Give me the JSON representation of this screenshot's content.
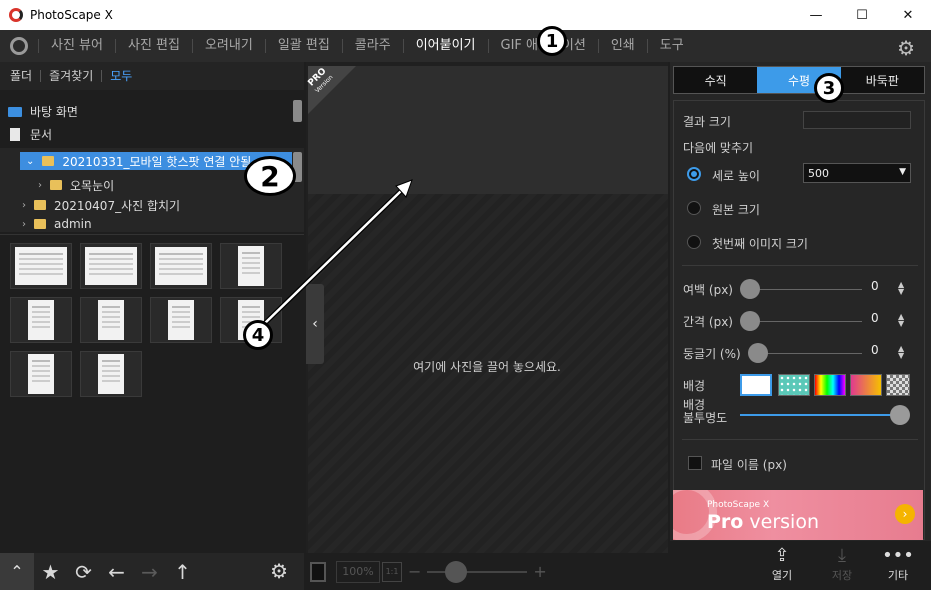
{
  "window": {
    "title": "PhotoScape X",
    "minimize": "—",
    "maximize": "☐",
    "close": "✕"
  },
  "menu": {
    "items": [
      "사진 뷰어",
      "사진 편집",
      "오려내기",
      "일괄 편집",
      "콜라주",
      "이어붙이기",
      "GIF 애니메이션",
      "인쇄",
      "도구"
    ],
    "active": "이어붙이기"
  },
  "browser": {
    "tabs": [
      "폴더",
      "즐겨찾기",
      "모두"
    ],
    "tree_top": [
      {
        "label": "바탕 화면"
      },
      {
        "label": "문서"
      }
    ],
    "tree": [
      {
        "label": "20210331_모바일 핫스팟 연결 안될",
        "selected": true
      },
      {
        "label": "오목눈이"
      },
      {
        "label": "20210407_사진 합치기"
      },
      {
        "label": "admin"
      }
    ]
  },
  "canvas": {
    "pro_label": "PRO",
    "pro_sub": "Version",
    "drop_hint": "여기에 사진을 끌어 놓으세요."
  },
  "zoom": {
    "value": "100%",
    "fit": "1:1"
  },
  "panel": {
    "tabs": [
      "수직",
      "수평",
      "바둑판"
    ],
    "active_tab": "수평",
    "result_size_label": "결과 크기",
    "fit_label": "다음에 맞추기",
    "options": [
      "세로 높이",
      "원본 크기",
      "첫번째 이미지 크기"
    ],
    "height_value": "500",
    "margin_label": "여백 (px)",
    "margin_value": "0",
    "spacing_label": "간격 (px)",
    "spacing_value": "0",
    "round_label": "둥글기 (%)",
    "round_value": "0",
    "bg_label": "배경",
    "bg_opacity_label_1": "배경",
    "bg_opacity_label_2": "불투명도",
    "bg_opacity_value": 1.0,
    "filename_label": "파일 이름 (px)"
  },
  "banner": {
    "small": "PhotoScape X",
    "big_1": "Pro",
    "big_2": " version"
  },
  "actions": {
    "open": "열기",
    "save": "저장",
    "more": "기타"
  },
  "annotations": [
    "1",
    "2",
    "3",
    "4"
  ],
  "colors": {
    "accent": "#3d9be9",
    "menu_bg": "#2b2b2b",
    "panel_bg": "#262626"
  }
}
